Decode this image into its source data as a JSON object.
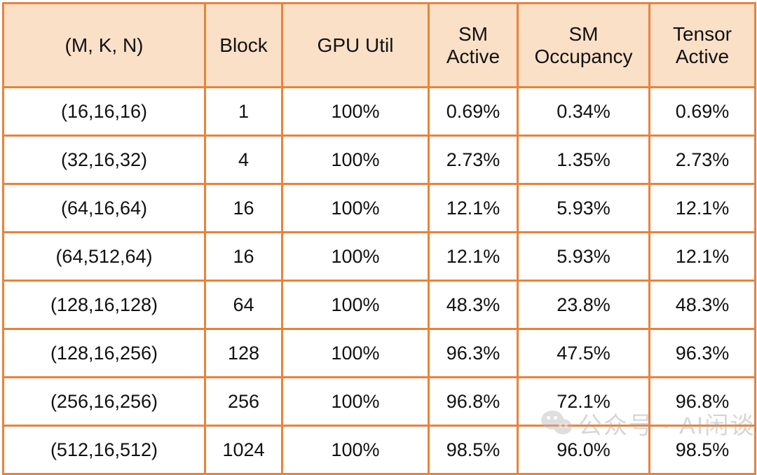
{
  "table": {
    "columns": [
      {
        "id": "mkn",
        "label_lines": [
          "(M, K, N)"
        ]
      },
      {
        "id": "block",
        "label_lines": [
          "Block"
        ]
      },
      {
        "id": "gpu",
        "label_lines": [
          "GPU Util"
        ]
      },
      {
        "id": "sm_active",
        "label_lines": [
          "SM",
          "Active"
        ]
      },
      {
        "id": "sm_occupancy",
        "label_lines": [
          "SM",
          "Occupancy"
        ]
      },
      {
        "id": "tensor_active",
        "label_lines": [
          "Tensor",
          "Active"
        ]
      }
    ],
    "rows": [
      {
        "mkn": "(16,16,16)",
        "block": "1",
        "gpu": "100%",
        "sm_active": "0.69%",
        "sm_occupancy": "0.34%",
        "tensor_active": "0.69%"
      },
      {
        "mkn": "(32,16,32)",
        "block": "4",
        "gpu": "100%",
        "sm_active": "2.73%",
        "sm_occupancy": "1.35%",
        "tensor_active": "2.73%"
      },
      {
        "mkn": "(64,16,64)",
        "block": "16",
        "gpu": "100%",
        "sm_active": "12.1%",
        "sm_occupancy": "5.93%",
        "tensor_active": "12.1%"
      },
      {
        "mkn": "(64,512,64)",
        "block": "16",
        "gpu": "100%",
        "sm_active": "12.1%",
        "sm_occupancy": "5.93%",
        "tensor_active": "12.1%"
      },
      {
        "mkn": "(128,16,128)",
        "block": "64",
        "gpu": "100%",
        "sm_active": "48.3%",
        "sm_occupancy": "23.8%",
        "tensor_active": "48.3%"
      },
      {
        "mkn": "(128,16,256)",
        "block": "128",
        "gpu": "100%",
        "sm_active": "96.3%",
        "sm_occupancy": "47.5%",
        "tensor_active": "96.3%"
      },
      {
        "mkn": "(256,16,256)",
        "block": "256",
        "gpu": "100%",
        "sm_active": "96.8%",
        "sm_occupancy": "72.1%",
        "tensor_active": "96.8%"
      },
      {
        "mkn": "(512,16,512)",
        "block": "1024",
        "gpu": "100%",
        "sm_active": "98.5%",
        "sm_occupancy": "96.0%",
        "tensor_active": "98.5%"
      }
    ]
  },
  "watermark": {
    "icon": "wechat-logo-icon",
    "text": "公众号 · AI闲谈"
  },
  "colors": {
    "header_background": "#FBE0C8",
    "border": "#E8833A",
    "cell_background": "#FFFFFF",
    "text": "#111111",
    "watermark_text": "#A8A8A8"
  }
}
